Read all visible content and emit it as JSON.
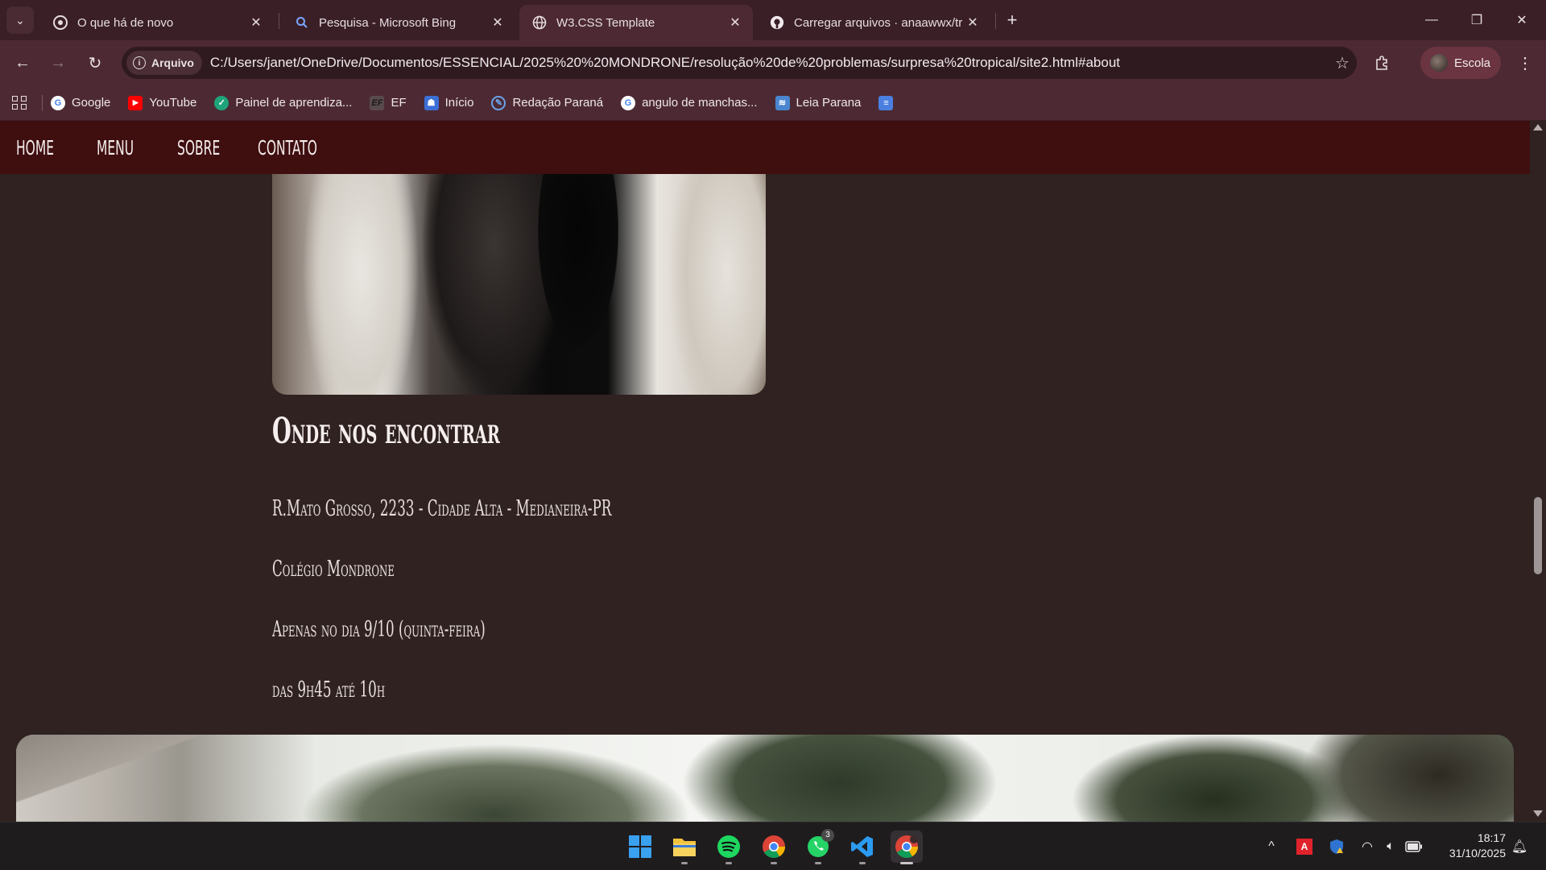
{
  "browser": {
    "tabs": [
      {
        "title": "O que há de novo",
        "icon": "chrome-icon",
        "active": false
      },
      {
        "title": "Pesquisa - Microsoft Bing",
        "icon": "bing-search-icon",
        "active": false
      },
      {
        "title": "W3.CSS Template",
        "icon": "globe-icon",
        "active": true
      },
      {
        "title": "Carregar arquivos · anaawwx/tr",
        "icon": "github-icon",
        "active": false
      }
    ],
    "address": {
      "chip_label": "Arquivo",
      "url": "C:/Users/janet/OneDrive/Documentos/ESSENCIAL/2025%20%20MONDRONE/resolução%20de%20problemas/surpresa%20tropical/site2.html#about"
    },
    "profile_label": "Escola",
    "bookmarks": [
      {
        "label": "Google",
        "icon": "google-icon"
      },
      {
        "label": "YouTube",
        "icon": "youtube-icon"
      },
      {
        "label": "Painel de aprendiza...",
        "icon": "learning-panel-icon"
      },
      {
        "label": "EF",
        "icon": "ef-icon"
      },
      {
        "label": "Início",
        "icon": "home-portal-icon"
      },
      {
        "label": "Redação Paraná",
        "icon": "redacao-icon"
      },
      {
        "label": "angulo de manchas...",
        "icon": "google-icon"
      },
      {
        "label": "Leia Parana",
        "icon": "leia-parana-icon"
      },
      {
        "label": "",
        "icon": "docs-icon"
      }
    ]
  },
  "site": {
    "nav": [
      "HOME",
      "MENU",
      "SOBRE",
      "CONTATO"
    ],
    "heading": "Onde nos encontrar",
    "paragraphs": [
      "R.Mato Grosso, 2233 - Cidade Alta - Medianeira-PR",
      "Colégio Mondrone",
      "Apenas no dia 9/10 (quinta-feira)",
      "das 9h45 até 10h"
    ]
  },
  "taskbar": {
    "apps": [
      "windows-start-icon",
      "file-explorer-icon",
      "spotify-icon",
      "chrome-icon",
      "whatsapp-icon",
      "vscode-icon",
      "chrome-profile-icon"
    ],
    "whatsapp_badge": "3",
    "time": "18:17",
    "date": "31/10/2025"
  },
  "colors": {
    "tabstrip": "#3a1f27",
    "toolbar": "#4d2a33",
    "site_nav": "#3f0e0f",
    "site_bg": "#2f2220"
  }
}
